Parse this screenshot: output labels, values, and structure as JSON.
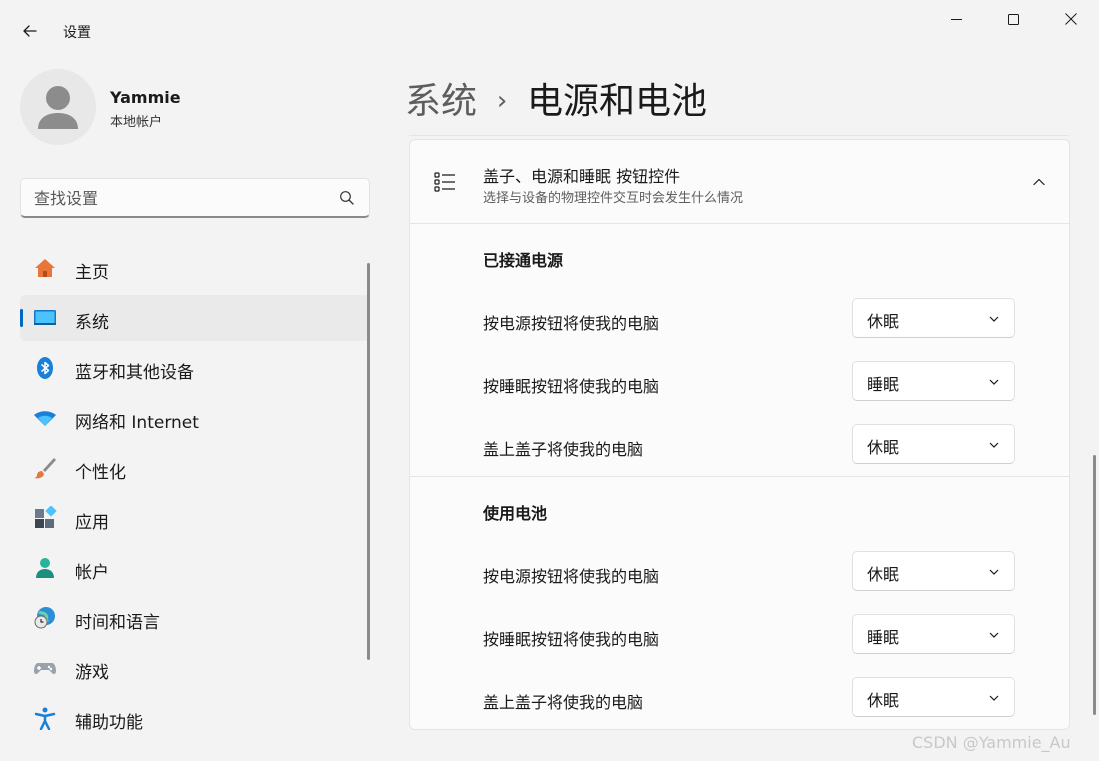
{
  "window": {
    "title": "设置"
  },
  "user": {
    "name": "Yammie",
    "account_type": "本地帐户"
  },
  "search": {
    "placeholder": "查找设置"
  },
  "nav": {
    "items": [
      {
        "label": "主页",
        "icon": "home-icon"
      },
      {
        "label": "系统",
        "icon": "system-icon",
        "selected": true
      },
      {
        "label": "蓝牙和其他设备",
        "icon": "bluetooth-icon"
      },
      {
        "label": "网络和 Internet",
        "icon": "wifi-icon"
      },
      {
        "label": "个性化",
        "icon": "brush-icon"
      },
      {
        "label": "应用",
        "icon": "apps-icon"
      },
      {
        "label": "帐户",
        "icon": "account-icon"
      },
      {
        "label": "时间和语言",
        "icon": "globe-clock-icon"
      },
      {
        "label": "游戏",
        "icon": "gamepad-icon"
      },
      {
        "label": "辅助功能",
        "icon": "accessibility-icon"
      }
    ]
  },
  "breadcrumb": {
    "parent": "系统",
    "separator": "›",
    "current": "电源和电池"
  },
  "card": {
    "title": "盖子、电源和睡眠 按钮控件",
    "subtitle": "选择与设备的物理控件交互时会发生什么情况",
    "sections": [
      {
        "title": "已接通电源",
        "rows": [
          {
            "label": "按电源按钮将使我的电脑",
            "value": "休眠"
          },
          {
            "label": "按睡眠按钮将使我的电脑",
            "value": "睡眠"
          },
          {
            "label": "盖上盖子将使我的电脑",
            "value": "休眠"
          }
        ]
      },
      {
        "title": "使用电池",
        "rows": [
          {
            "label": "按电源按钮将使我的电脑",
            "value": "休眠"
          },
          {
            "label": "按睡眠按钮将使我的电脑",
            "value": "睡眠"
          },
          {
            "label": "盖上盖子将使我的电脑",
            "value": "休眠"
          }
        ]
      }
    ]
  },
  "watermark": "CSDN @Yammie_Au",
  "colors": {
    "accent": "#0067c0",
    "background": "#f3f3f3",
    "card": "#fbfbfb"
  }
}
